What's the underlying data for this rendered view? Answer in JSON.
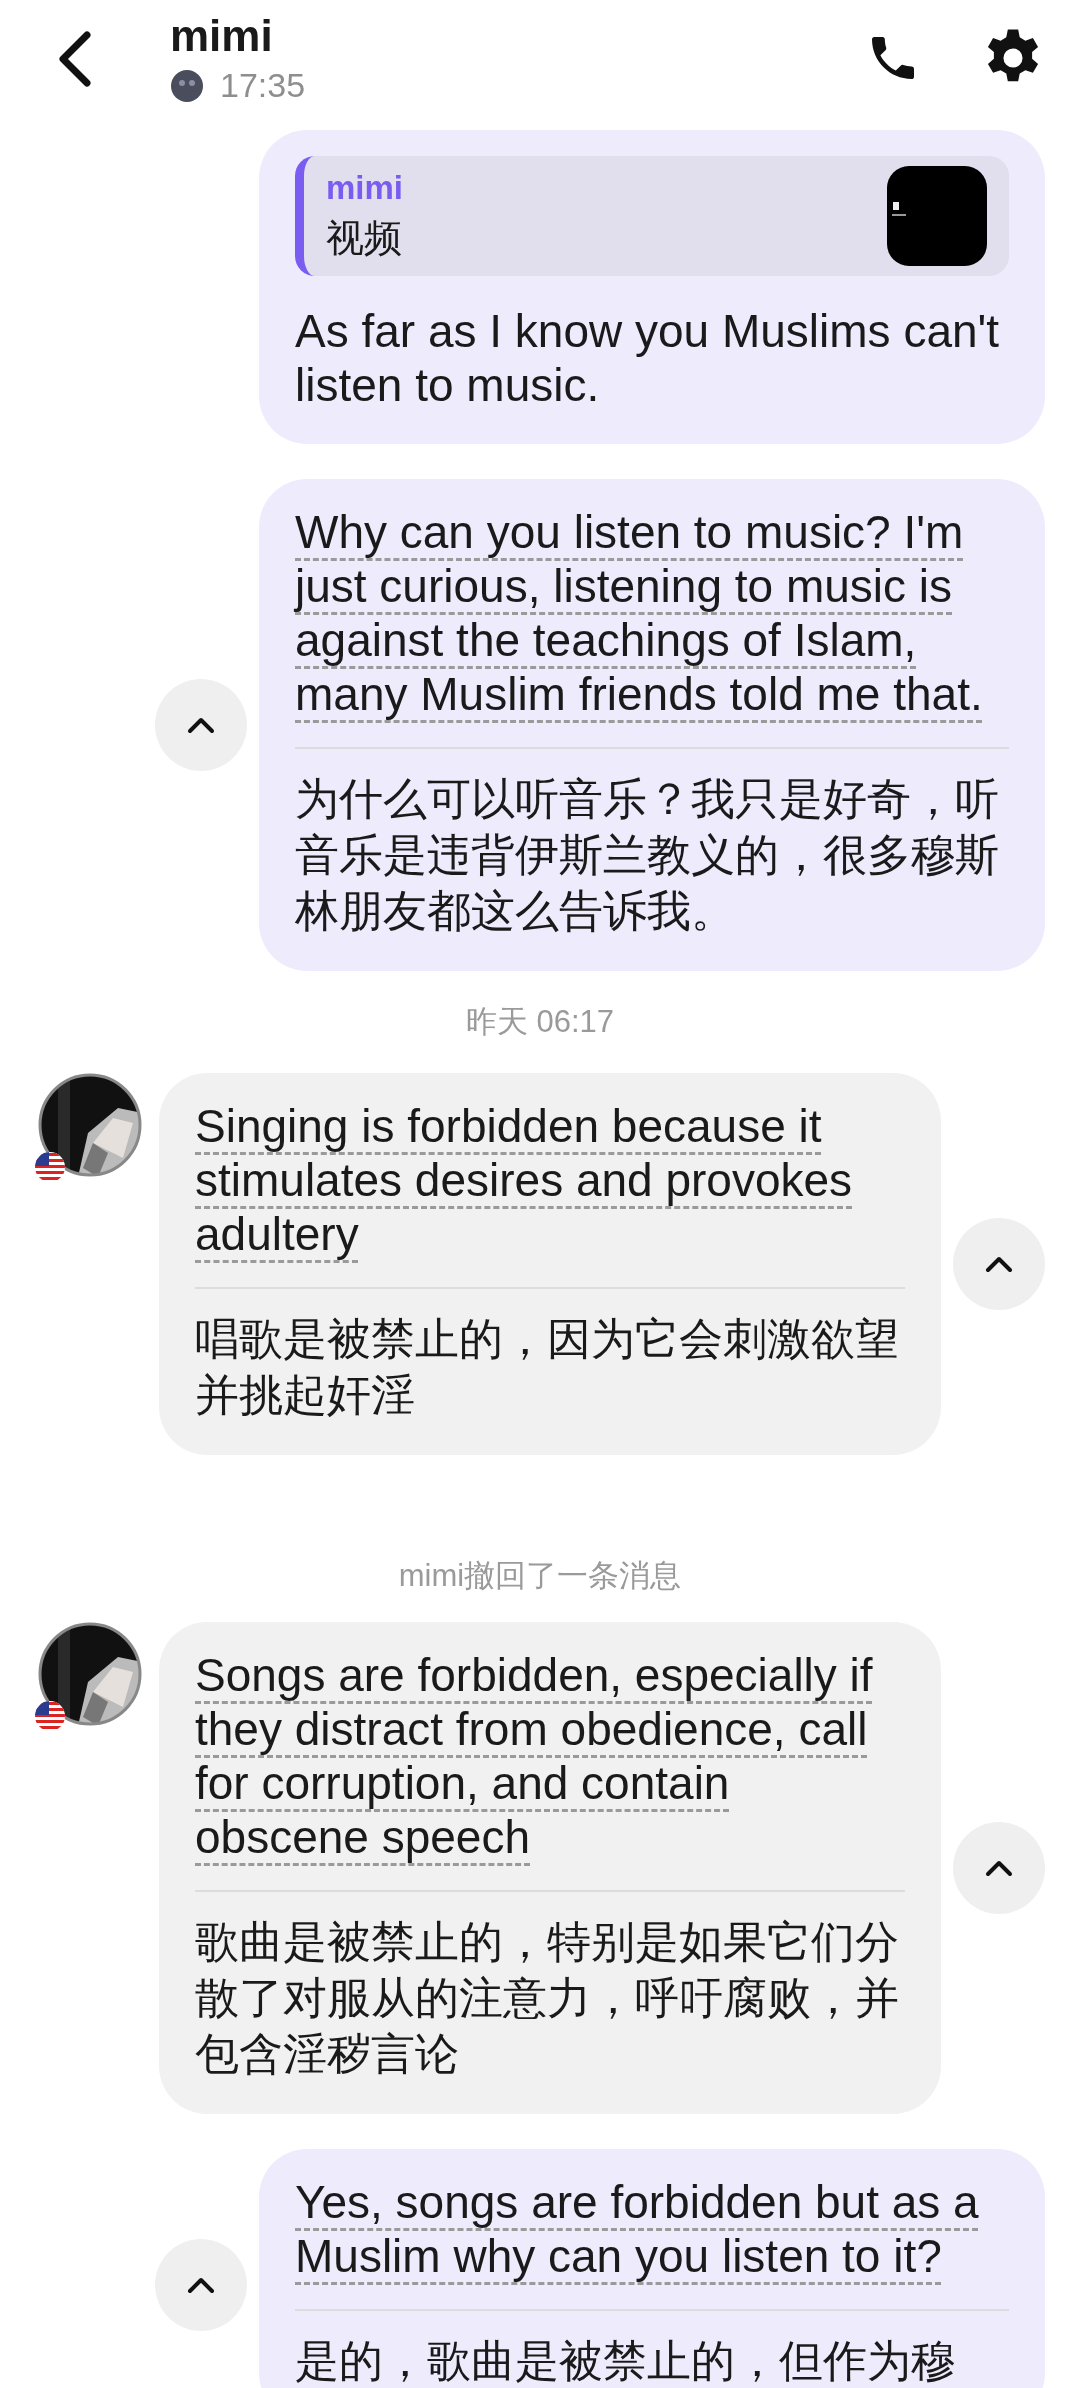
{
  "header": {
    "name": "mimi",
    "status_time": "17:35"
  },
  "messages": [
    {
      "kind": "outgoing",
      "quote": {
        "name": "mimi",
        "text": "视频"
      },
      "text": "As far as I know you Muslims can't listen to music.",
      "collapsible": false
    },
    {
      "kind": "outgoing",
      "text": "Why can you listen to music? I'm just curious, listening to music is against the teachings of Islam, many Muslim friends told me that.",
      "translation": "为什么可以听音乐？我只是好奇，听音乐是违背伊斯兰教义的，很多穆斯林朋友都这么告诉我。",
      "collapsible": true
    },
    {
      "kind": "timestamp",
      "text": "昨天 06:17"
    },
    {
      "kind": "incoming",
      "text": "Singing is forbidden because it stimulates desires and provokes adultery",
      "translation": "唱歌是被禁止的，因为它会刺激欲望并挑起奸淫",
      "collapsible": true
    },
    {
      "kind": "notice",
      "text": "mimi撤回了一条消息"
    },
    {
      "kind": "incoming",
      "text": "Songs are forbidden, especially if they distract from obedience, call for corruption, and contain obscene speech",
      "translation": "歌曲是被禁止的，特别是如果它们分散了对服从的注意力，呼吁腐败，并包含淫秽言论",
      "collapsible": true
    },
    {
      "kind": "outgoing",
      "text": "Yes, songs are forbidden but as a Muslim why can you listen to it?",
      "translation": "是的，歌曲是被禁止的，但作为穆",
      "collapsible": true
    }
  ]
}
